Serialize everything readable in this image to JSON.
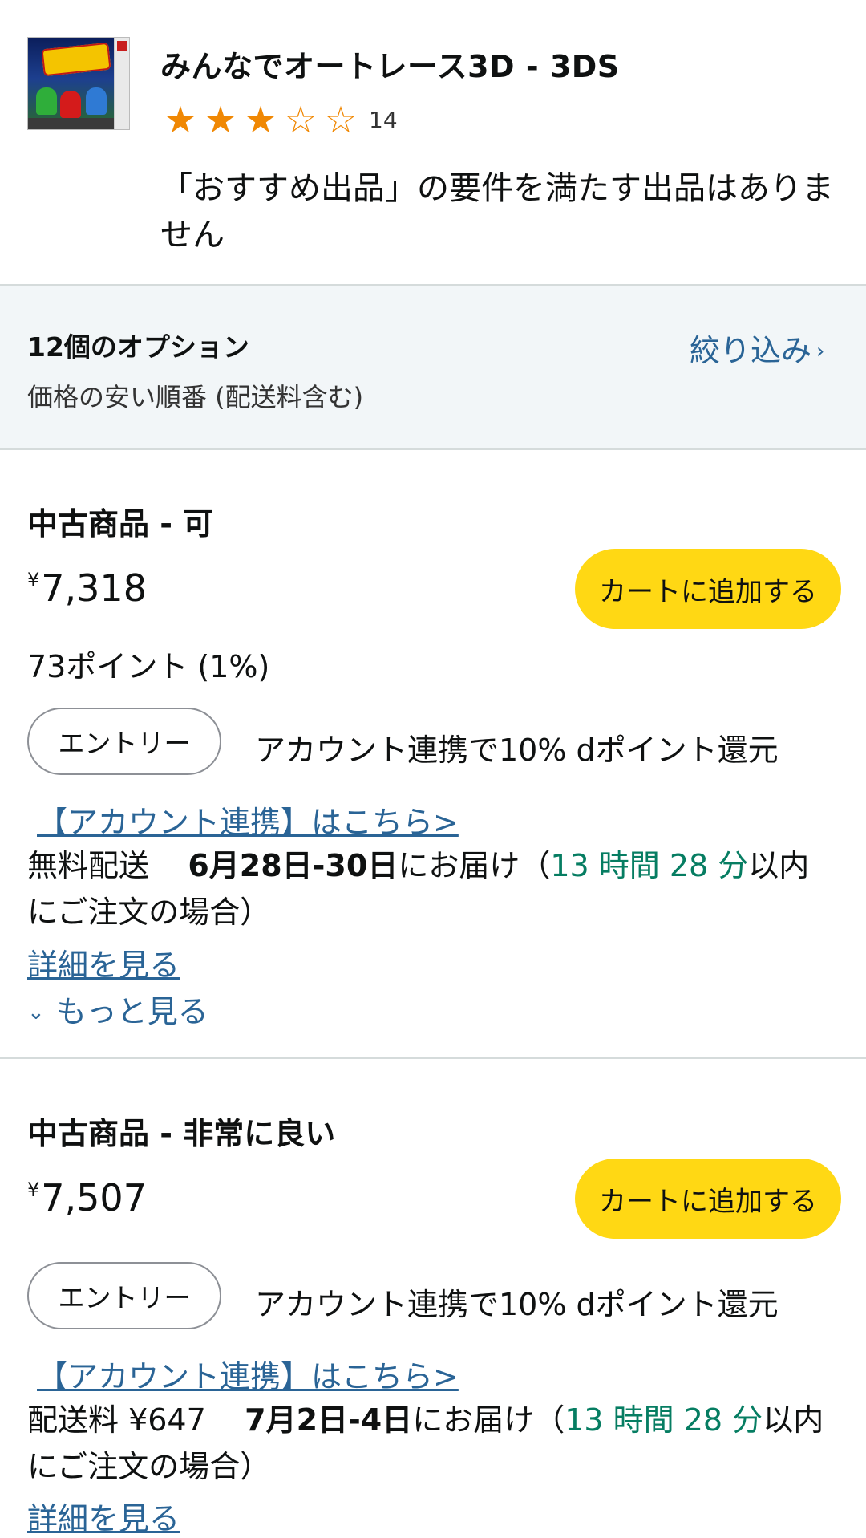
{
  "product": {
    "title": "みんなでオートレース3D - 3DS",
    "rating": 3,
    "rating_max": 5,
    "review_count": "14",
    "no_recommended": "「おすすめ出品」の要件を満たす出品はありません",
    "star_full": "★",
    "star_empty": "☆"
  },
  "options": {
    "count_label": "12個のオプション",
    "sort_label": "価格の安い順番 (配送料含む)",
    "filter_label": "絞り込み",
    "filter_chevron": "›"
  },
  "offers": [
    {
      "condition": "中古商品 - 可",
      "price_symbol": "¥",
      "price": "7,318",
      "cart_label": "カートに追加する",
      "points": "73ポイント (1%)",
      "entry_label": "エントリー",
      "promo": "アカウント連携で10% dポイント還元",
      "link_label": "【アカウント連携】はこちら>",
      "shipping_prefix": "無料配送",
      "delivery_date": "6月28日-30日",
      "delivery_suffix": "にお届け（",
      "countdown": "13 時間 28 分",
      "order_suffix": "以内にご注文の場合）",
      "details_label": "詳細を見る",
      "more_label": "もっと見る",
      "more_chevron": "⌄"
    },
    {
      "condition": "中古商品 - 非常に良い",
      "price_symbol": "¥",
      "price": "7,507",
      "cart_label": "カートに追加する",
      "entry_label": "エントリー",
      "promo": "アカウント連携で10% dポイント還元",
      "link_label": "【アカウント連携】はこちら>",
      "shipping_prefix": "配送料 ¥647",
      "delivery_date": "7月2日-4日",
      "delivery_suffix": "にお届け（",
      "countdown": "13 時間 28 分",
      "order_suffix": "以内にご注文の場合）",
      "details_label": "詳細を見る"
    }
  ],
  "colors": {
    "cart_button": "#ffd814",
    "link": "#2a6496",
    "countdown": "#067d62",
    "star": "#f08804",
    "options_band": "#f2f6f8"
  }
}
